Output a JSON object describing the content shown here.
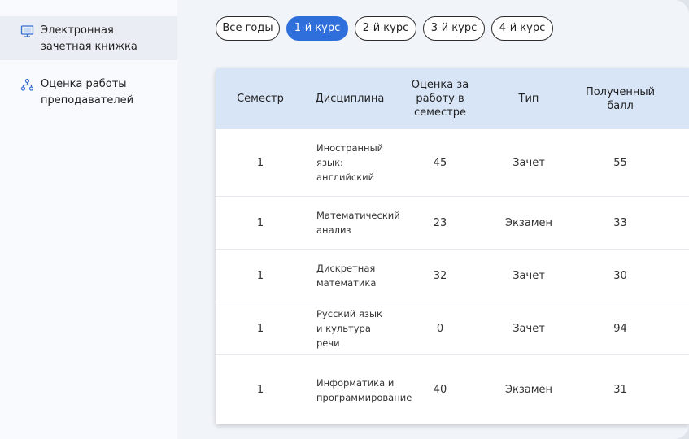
{
  "sidebar": {
    "items": [
      {
        "label": "Электронная зачетная книжка",
        "icon": "monitor-icon",
        "active": true
      },
      {
        "label": "Оценка работы преподавателей",
        "icon": "org-chart-icon",
        "active": false
      }
    ]
  },
  "tabs": [
    {
      "label": "Все годы",
      "active": false
    },
    {
      "label": "1-й курс",
      "active": true
    },
    {
      "label": "2-й курс",
      "active": false
    },
    {
      "label": "3-й курс",
      "active": false
    },
    {
      "label": "4-й курс",
      "active": false
    }
  ],
  "table": {
    "headers": [
      "Семестр",
      "Дисциплина",
      "Оценка за работу в семестре",
      "Тип",
      "Полученный балл"
    ],
    "rows": [
      {
        "semester": "1",
        "discipline": "Иностранный язык: английский",
        "score": "45",
        "type": "Зачет",
        "points": "55"
      },
      {
        "semester": "1",
        "discipline": "Математический анализ",
        "score": "23",
        "type": "Экзамен",
        "points": "33"
      },
      {
        "semester": "1",
        "discipline": "Дискретная математика",
        "score": "32",
        "type": "Зачет",
        "points": "30"
      },
      {
        "semester": "1",
        "discipline": "Русский язык и культура речи",
        "score": "0",
        "type": "Зачет",
        "points": "94"
      },
      {
        "semester": "1",
        "discipline": "Информатика и программирование",
        "score": "40",
        "type": "Экзамен",
        "points": "31"
      }
    ]
  },
  "colors": {
    "accent": "#2f6fdc",
    "table_header_bg": "#d8e5f7",
    "icon": "#3a6fd0"
  }
}
